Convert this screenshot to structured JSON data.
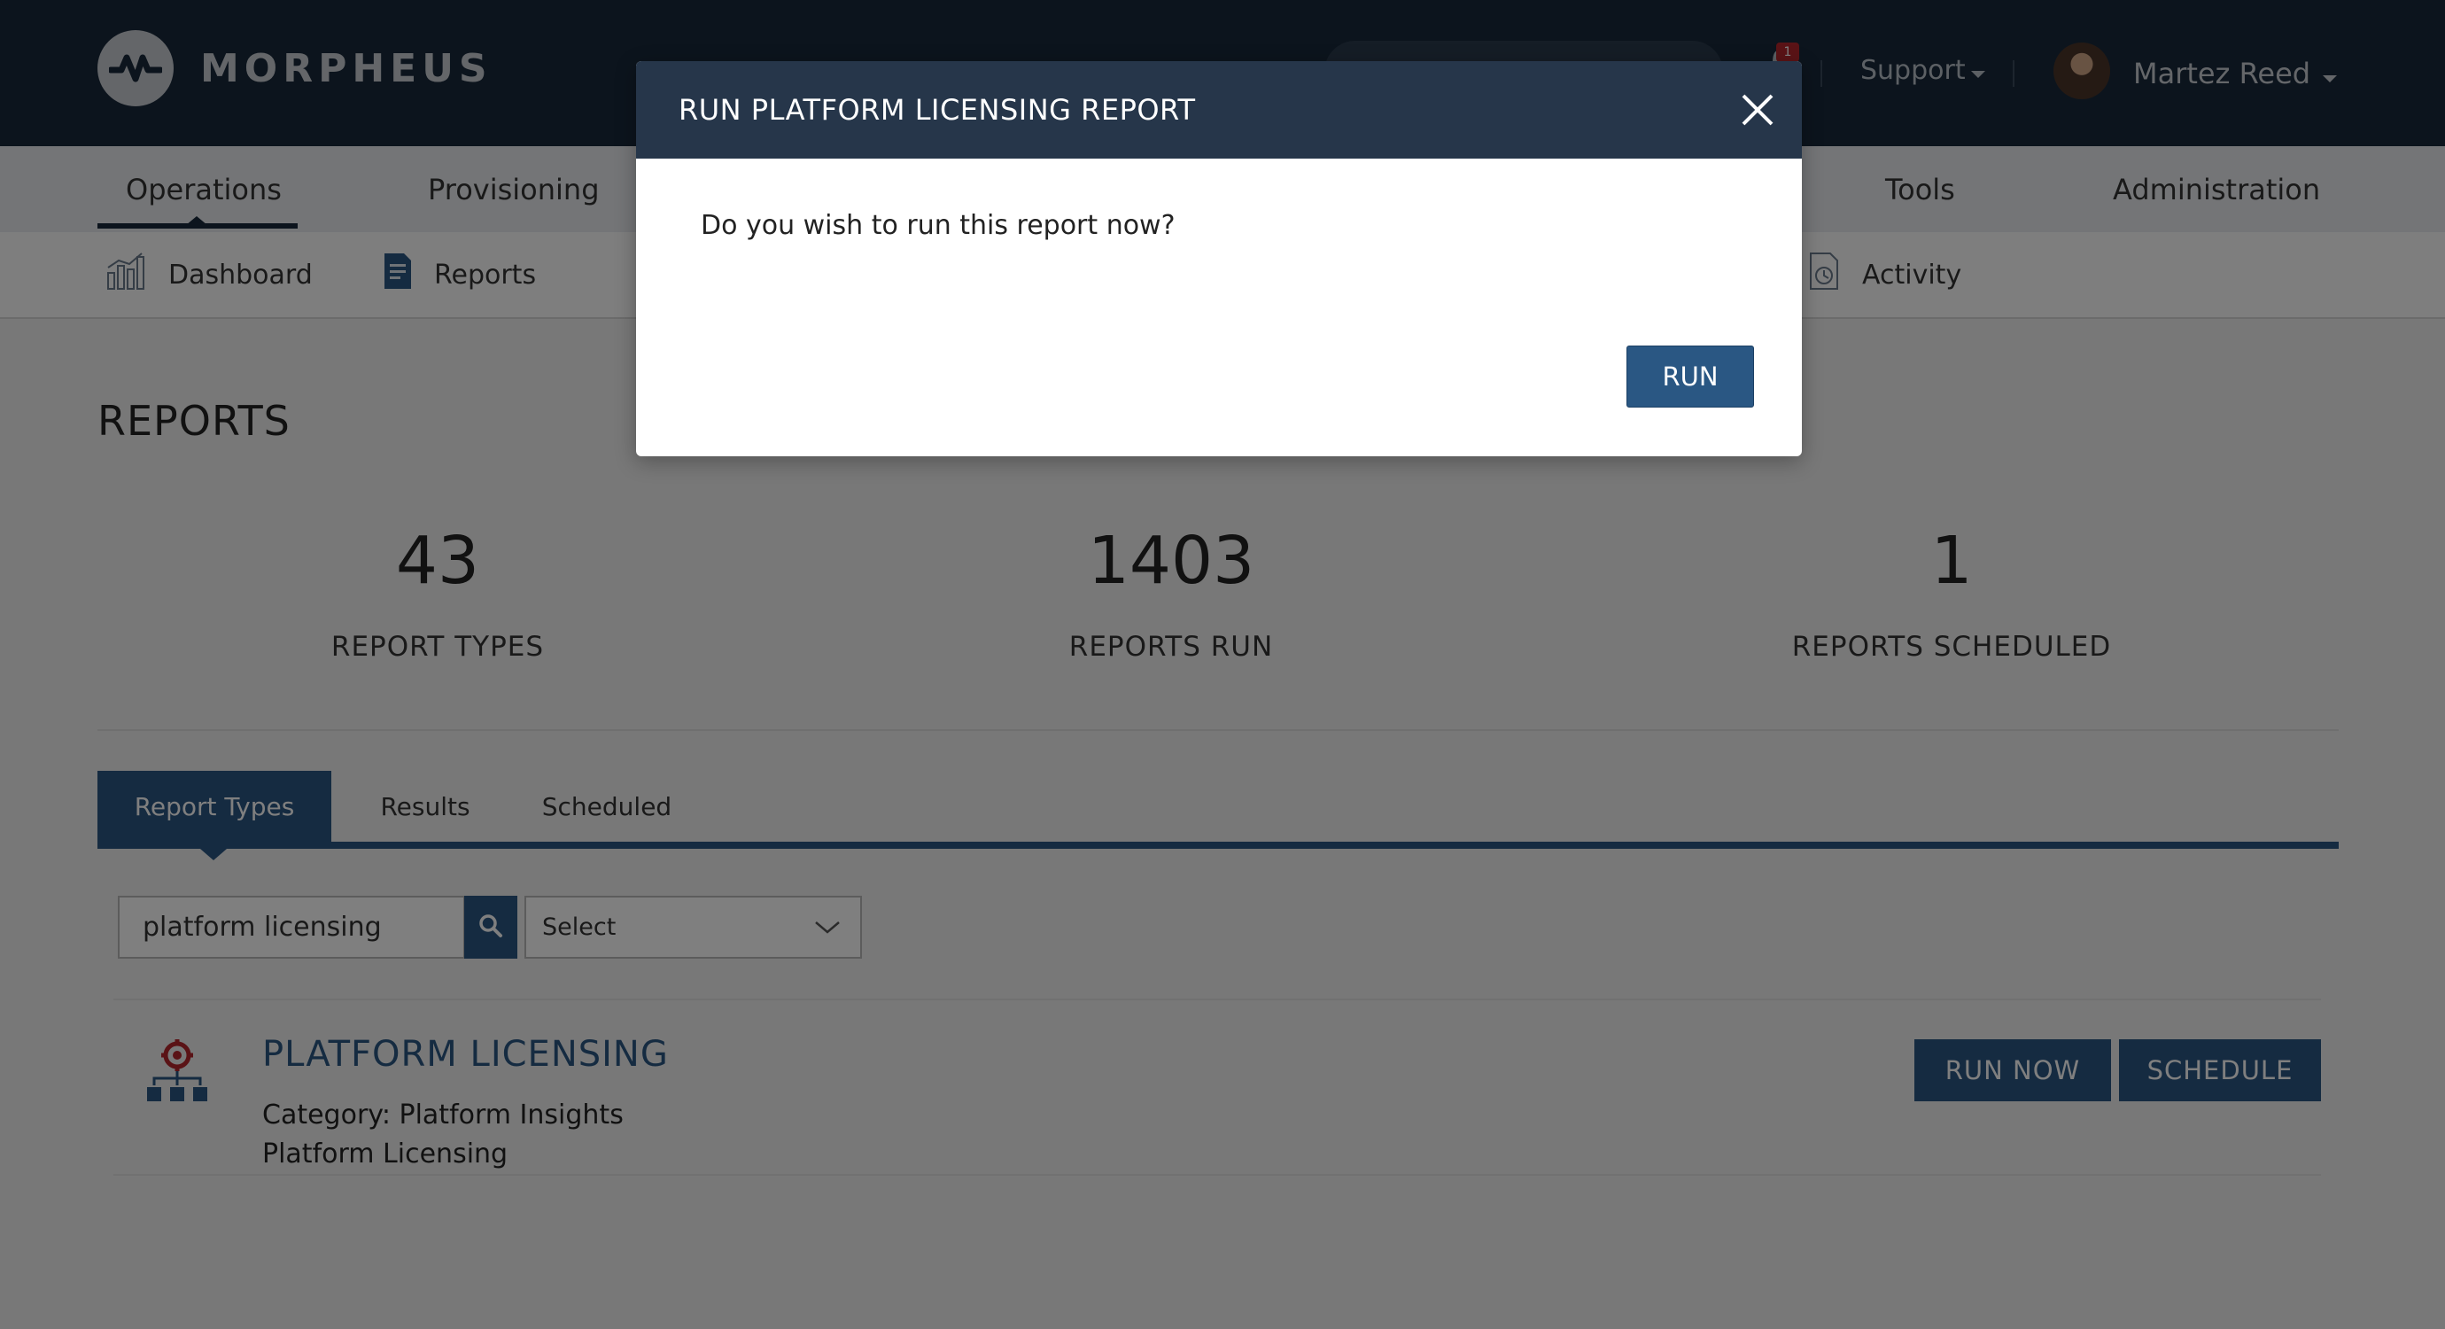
{
  "app": {
    "brand": "MORPHEUS"
  },
  "header": {
    "support_label": "Support",
    "user_name": "Martez Reed",
    "notification_count": "1"
  },
  "main_nav": {
    "items": [
      {
        "label": "Operations",
        "active": true
      },
      {
        "label": "Provisioning"
      },
      {
        "label": "Tools"
      },
      {
        "label": "Administration"
      }
    ]
  },
  "sub_nav": {
    "items": [
      {
        "label": "Dashboard",
        "icon": "dashboard-chart-icon"
      },
      {
        "label": "Reports",
        "icon": "report-document-icon"
      },
      {
        "label": "Activity",
        "icon": "activity-clock-icon"
      }
    ]
  },
  "page": {
    "title": "REPORTS",
    "stats": [
      {
        "value": "43",
        "label": "REPORT TYPES"
      },
      {
        "value": "1403",
        "label": "REPORTS RUN"
      },
      {
        "value": "1",
        "label": "REPORTS SCHEDULED"
      }
    ],
    "tabs": [
      {
        "label": "Report Types",
        "active": true
      },
      {
        "label": "Results"
      },
      {
        "label": "Scheduled"
      }
    ],
    "search": {
      "value": "platform licensing"
    },
    "filter": {
      "selected": "Select"
    },
    "report": {
      "title": "PLATFORM LICENSING",
      "category": "Category: Platform Insights",
      "description": "Platform Licensing",
      "run_now_label": "RUN NOW",
      "schedule_label": "SCHEDULE",
      "icon": "platform-gear-hierarchy-icon"
    }
  },
  "modal": {
    "title": "RUN PLATFORM LICENSING REPORT",
    "message": "Do you wish to run this report now?",
    "run_label": "RUN"
  },
  "colors": {
    "header_bg": "#19293b",
    "accent": "#2a5783",
    "modal_header": "#26364a",
    "badge": "#b5272d"
  }
}
